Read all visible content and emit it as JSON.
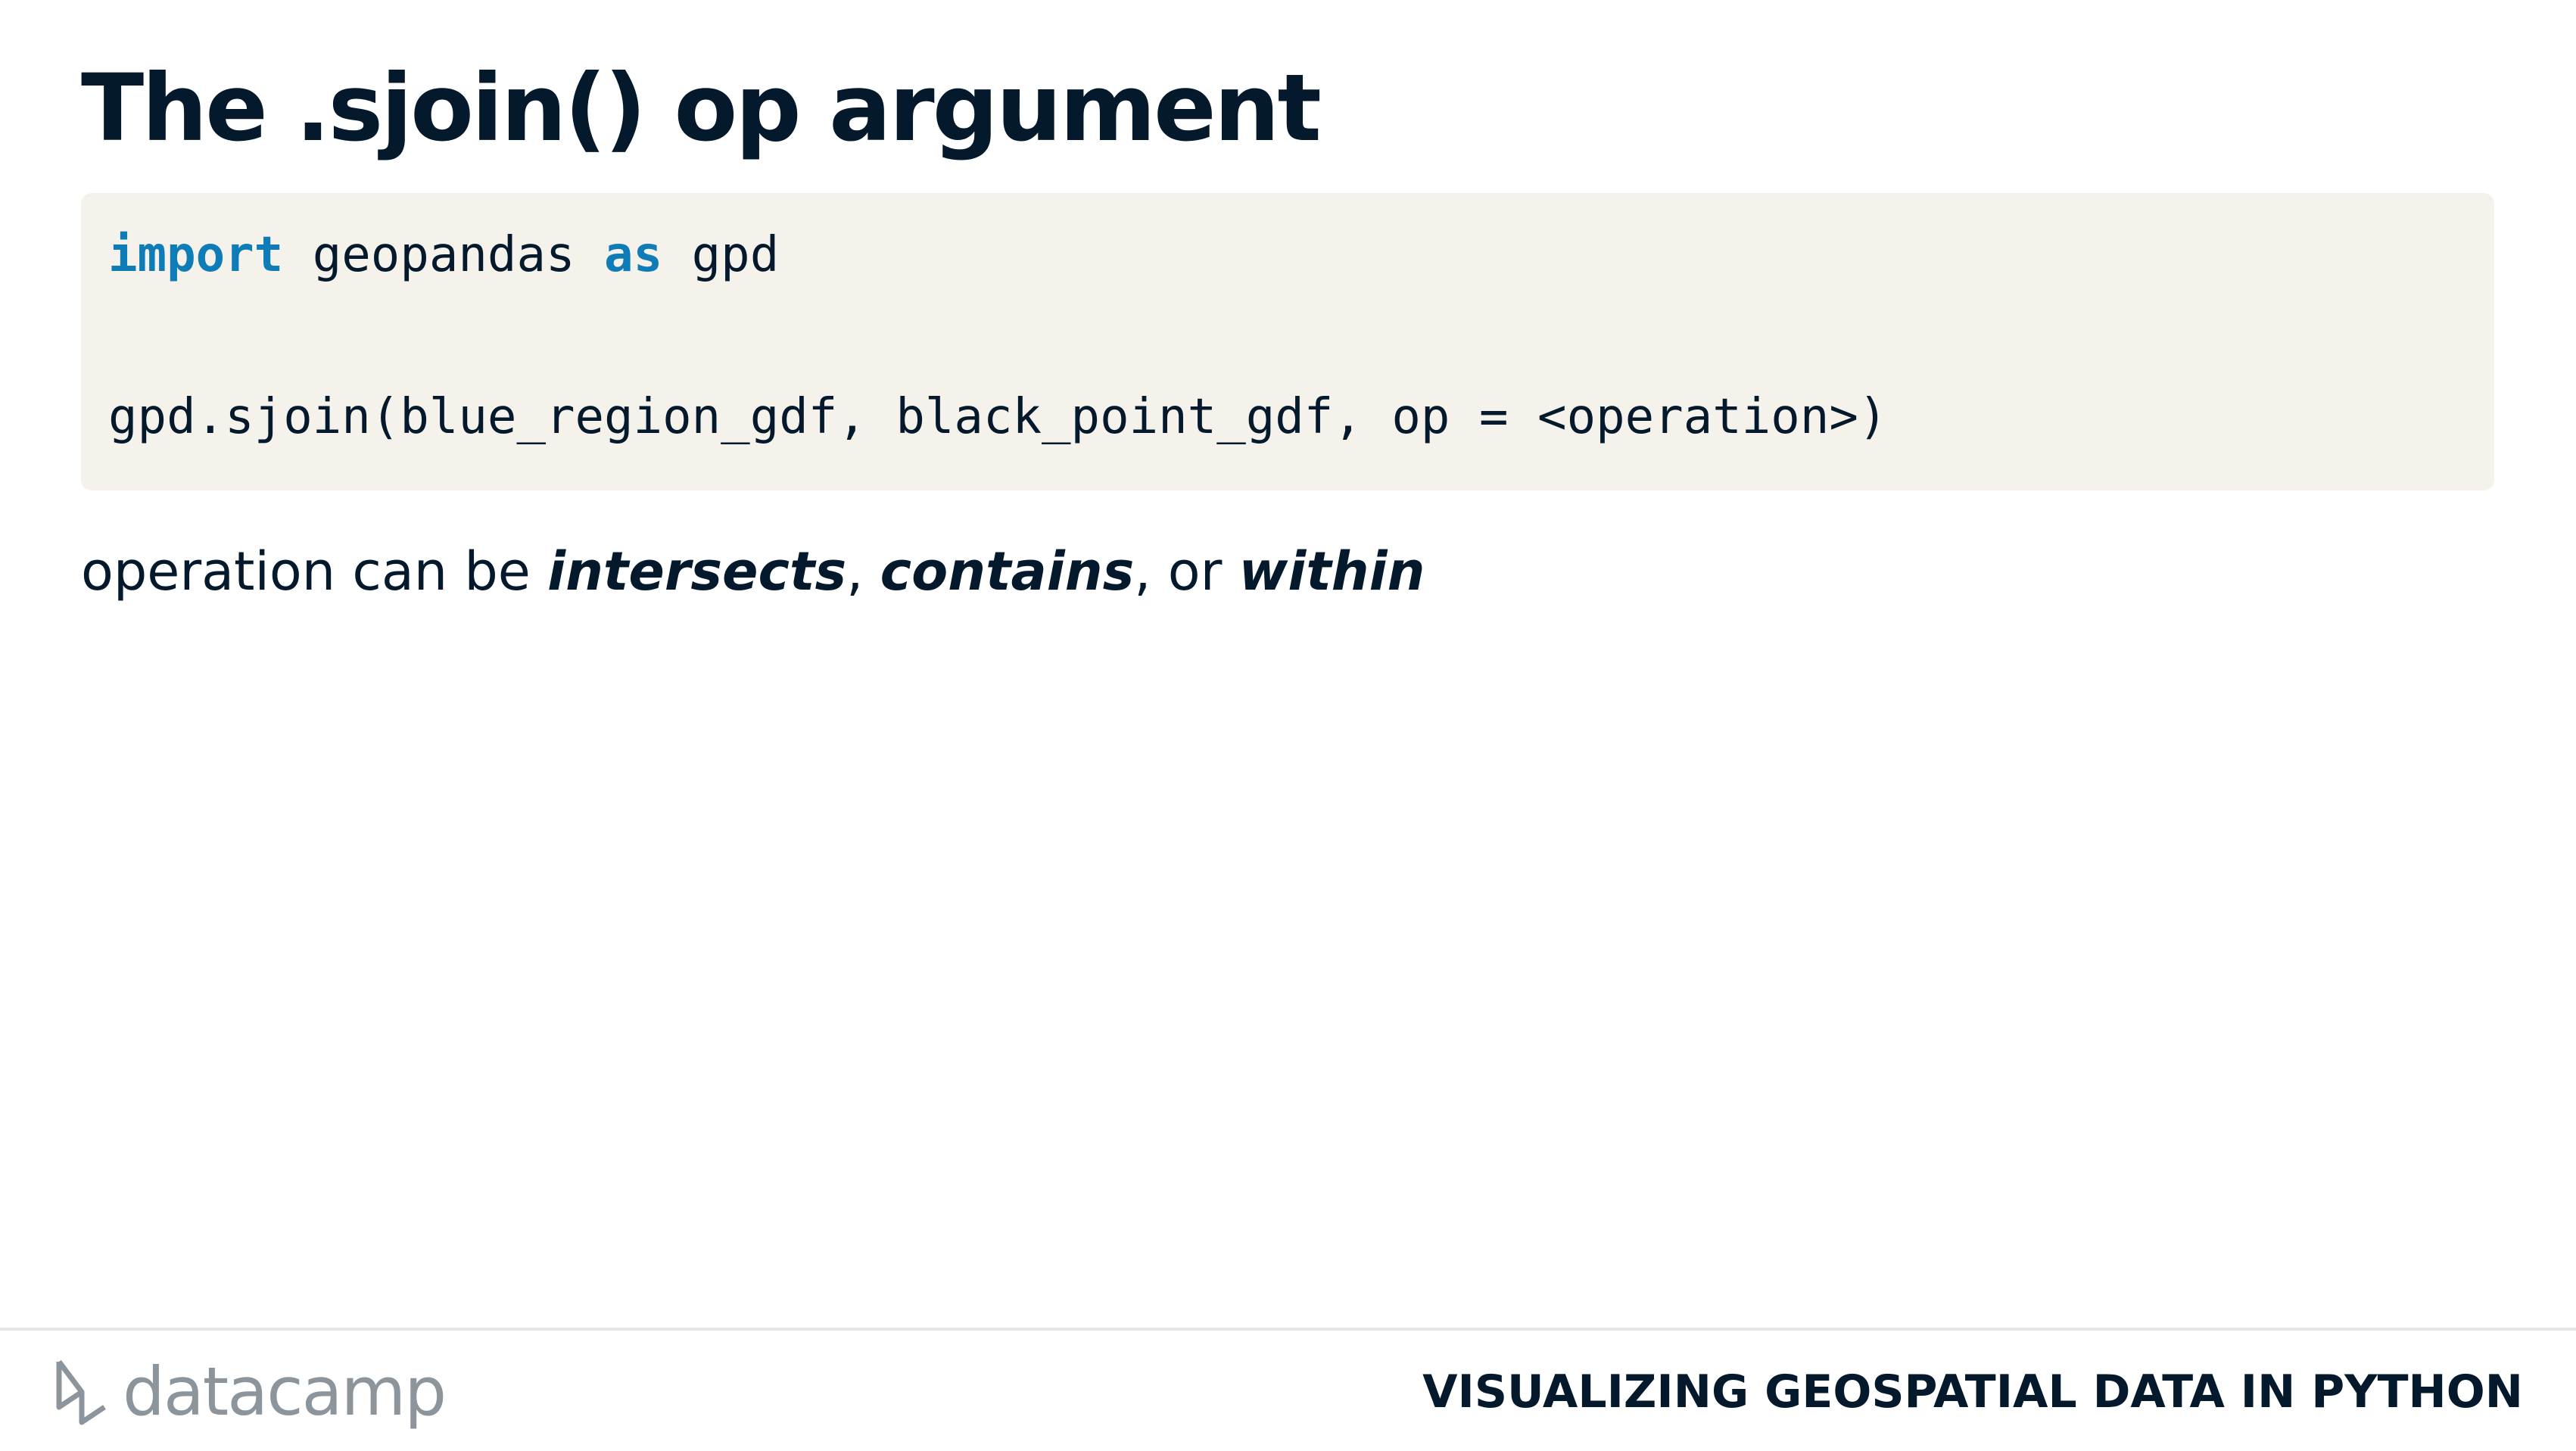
{
  "slide": {
    "title": "The .sjoin() op argument"
  },
  "code": {
    "line1": {
      "kw_import": "import",
      "module": " geopandas ",
      "kw_as": "as",
      "alias": " gpd"
    },
    "line2": "gpd.sjoin(blue_region_gdf, black_point_gdf, op = <operation>)"
  },
  "body": {
    "prefix": "operation can be ",
    "option1": "intersects",
    "sep1": ", ",
    "option2": "contains",
    "sep2": ", or ",
    "option3": "within"
  },
  "footer": {
    "brand": "datacamp",
    "course": "VISUALIZING GEOSPATIAL DATA IN PYTHON"
  },
  "colors": {
    "text": "#05192d",
    "keyword": "#0d7cb7",
    "code_background": "#f5f2eb",
    "logo_gray": "#8d959c"
  }
}
